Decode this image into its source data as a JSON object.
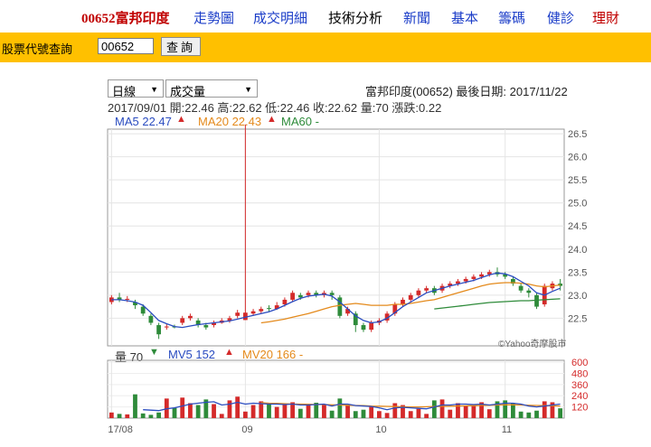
{
  "nav": {
    "brand": "00652富邦印度",
    "links": [
      {
        "label": "走勢圖",
        "color": "#1a3cc8"
      },
      {
        "label": "成交明細",
        "color": "#1a3cc8"
      },
      {
        "label": "技術分析",
        "color": "#000000"
      },
      {
        "label": "新聞",
        "color": "#1a3cc8"
      },
      {
        "label": "基本",
        "color": "#1a3cc8"
      },
      {
        "label": "籌碼",
        "color": "#1a3cc8"
      },
      {
        "label": "健診",
        "color": "#1a3cc8"
      },
      {
        "label": "理財",
        "color": "#c00000"
      }
    ]
  },
  "search": {
    "label": "股票代號查詢",
    "value": "00652",
    "button": "查詢"
  },
  "controls": {
    "period": "日線",
    "indicator": "成交量"
  },
  "info": {
    "title": "富邦印度(00652)  最後日期: 2017/11/22",
    "ohlc": "2017/09/01 開:22.46 高:22.62 低:22.46 收:22.62 量:70 漲跌:0.22",
    "ma5": "MA5 22.47",
    "ma20": "MA20 22.43",
    "ma60": "MA60 -",
    "vol": "量 70",
    "mv5": "MV5 152",
    "mv20": "MV20 166 -"
  },
  "colors": {
    "up": "#d42a2a",
    "down": "#2e8b3a",
    "ma5": "#2a4cc0",
    "ma20": "#e48a1c",
    "ma60": "#2e8b3a"
  },
  "watermark": "©Yahoo奇摩股市",
  "chart_data": {
    "type": "candlestick",
    "price_ticks": [
      22.5,
      23.0,
      23.5,
      24.0,
      24.5,
      25.0,
      25.5,
      26.0,
      26.5
    ],
    "price_range": [
      21.9,
      26.6
    ],
    "volume_ticks": [
      120,
      240,
      360,
      480,
      600
    ],
    "volume_range": [
      0,
      620
    ],
    "x_labels": [
      {
        "label": "17/08",
        "i": 0
      },
      {
        "label": "09",
        "i": 17
      },
      {
        "label": "10",
        "i": 34
      },
      {
        "label": "11",
        "i": 50
      }
    ],
    "candles": [
      {
        "o": 22.85,
        "c": 22.95,
        "h": 23.0,
        "l": 22.8
      },
      {
        "o": 22.95,
        "c": 22.9,
        "h": 23.05,
        "l": 22.85
      },
      {
        "o": 22.9,
        "c": 22.92,
        "h": 22.98,
        "l": 22.85
      },
      {
        "o": 22.85,
        "c": 22.78,
        "h": 22.9,
        "l": 22.7
      },
      {
        "o": 22.75,
        "c": 22.6,
        "h": 22.8,
        "l": 22.55
      },
      {
        "o": 22.55,
        "c": 22.4,
        "h": 22.6,
        "l": 22.35
      },
      {
        "o": 22.35,
        "c": 22.15,
        "h": 22.4,
        "l": 22.05
      },
      {
        "o": 22.3,
        "c": 22.32,
        "h": 22.38,
        "l": 22.25
      },
      {
        "o": 22.32,
        "c": 22.3,
        "h": 22.36,
        "l": 22.28
      },
      {
        "o": 22.4,
        "c": 22.5,
        "h": 22.55,
        "l": 22.35
      },
      {
        "o": 22.5,
        "c": 22.55,
        "h": 22.6,
        "l": 22.45
      },
      {
        "o": 22.45,
        "c": 22.35,
        "h": 22.5,
        "l": 22.3
      },
      {
        "o": 22.35,
        "c": 22.3,
        "h": 22.4,
        "l": 22.25
      },
      {
        "o": 22.35,
        "c": 22.4,
        "h": 22.45,
        "l": 22.3
      },
      {
        "o": 22.4,
        "c": 22.45,
        "h": 22.5,
        "l": 22.38
      },
      {
        "o": 22.45,
        "c": 22.5,
        "h": 22.55,
        "l": 22.4
      },
      {
        "o": 22.55,
        "c": 22.62,
        "h": 22.68,
        "l": 22.5
      },
      {
        "o": 22.46,
        "c": 22.62,
        "h": 26.7,
        "l": 22.46
      },
      {
        "o": 22.6,
        "c": 22.65,
        "h": 22.7,
        "l": 22.55
      },
      {
        "o": 22.65,
        "c": 22.7,
        "h": 22.75,
        "l": 22.6
      },
      {
        "o": 22.72,
        "c": 22.7,
        "h": 22.78,
        "l": 22.65
      },
      {
        "o": 22.7,
        "c": 22.78,
        "h": 22.85,
        "l": 22.68
      },
      {
        "o": 22.8,
        "c": 22.9,
        "h": 22.95,
        "l": 22.75
      },
      {
        "o": 22.9,
        "c": 23.05,
        "h": 23.1,
        "l": 22.85
      },
      {
        "o": 23.0,
        "c": 22.95,
        "h": 23.05,
        "l": 22.9
      },
      {
        "o": 23.0,
        "c": 23.05,
        "h": 23.1,
        "l": 22.95
      },
      {
        "o": 23.05,
        "c": 23.0,
        "h": 23.1,
        "l": 22.95
      },
      {
        "o": 23.0,
        "c": 23.05,
        "h": 23.1,
        "l": 22.95
      },
      {
        "o": 23.05,
        "c": 23.0,
        "h": 23.1,
        "l": 22.9
      },
      {
        "o": 22.95,
        "c": 22.55,
        "h": 23.0,
        "l": 22.5
      },
      {
        "o": 22.6,
        "c": 22.7,
        "h": 22.75,
        "l": 22.55
      },
      {
        "o": 22.6,
        "c": 22.35,
        "h": 22.65,
        "l": 22.2
      },
      {
        "o": 22.35,
        "c": 22.25,
        "h": 22.4,
        "l": 22.2
      },
      {
        "o": 22.25,
        "c": 22.4,
        "h": 22.45,
        "l": 22.2
      },
      {
        "o": 22.4,
        "c": 22.45,
        "h": 22.5,
        "l": 22.35
      },
      {
        "o": 22.45,
        "c": 22.6,
        "h": 22.65,
        "l": 22.4
      },
      {
        "o": 22.6,
        "c": 22.8,
        "h": 22.85,
        "l": 22.55
      },
      {
        "o": 22.8,
        "c": 22.9,
        "h": 22.95,
        "l": 22.75
      },
      {
        "o": 22.9,
        "c": 23.0,
        "h": 23.05,
        "l": 22.85
      },
      {
        "o": 23.0,
        "c": 23.1,
        "h": 23.15,
        "l": 22.95
      },
      {
        "o": 23.1,
        "c": 23.15,
        "h": 23.2,
        "l": 23.05
      },
      {
        "o": 23.15,
        "c": 23.05,
        "h": 23.2,
        "l": 23.0
      },
      {
        "o": 23.1,
        "c": 23.2,
        "h": 23.25,
        "l": 23.05
      },
      {
        "o": 23.2,
        "c": 23.25,
        "h": 23.3,
        "l": 23.15
      },
      {
        "o": 23.25,
        "c": 23.3,
        "h": 23.35,
        "l": 23.2
      },
      {
        "o": 23.3,
        "c": 23.35,
        "h": 23.4,
        "l": 23.25
      },
      {
        "o": 23.35,
        "c": 23.4,
        "h": 23.45,
        "l": 23.3
      },
      {
        "o": 23.4,
        "c": 23.45,
        "h": 23.5,
        "l": 23.35
      },
      {
        "o": 23.45,
        "c": 23.5,
        "h": 23.55,
        "l": 23.4
      },
      {
        "o": 23.5,
        "c": 23.45,
        "h": 23.6,
        "l": 23.4
      },
      {
        "o": 23.45,
        "c": 23.4,
        "h": 23.5,
        "l": 23.35
      },
      {
        "o": 23.35,
        "c": 23.25,
        "h": 23.4,
        "l": 23.2
      },
      {
        "o": 23.2,
        "c": 23.1,
        "h": 23.25,
        "l": 23.05
      },
      {
        "o": 23.1,
        "c": 23.05,
        "h": 23.15,
        "l": 22.95
      },
      {
        "o": 23.0,
        "c": 22.75,
        "h": 23.05,
        "l": 22.7
      },
      {
        "o": 22.8,
        "c": 23.2,
        "h": 23.25,
        "l": 22.75
      },
      {
        "o": 23.15,
        "c": 23.25,
        "h": 23.3,
        "l": 23.1
      },
      {
        "o": 23.25,
        "c": 23.2,
        "h": 23.35,
        "l": 23.1
      }
    ],
    "volumes": [
      60,
      45,
      40,
      255,
      50,
      35,
      60,
      210,
      110,
      220,
      160,
      140,
      200,
      150,
      45,
      190,
      230,
      70,
      140,
      180,
      150,
      120,
      155,
      170,
      100,
      140,
      165,
      150,
      80,
      210,
      140,
      75,
      90,
      120,
      75,
      55,
      160,
      140,
      75,
      100,
      45,
      190,
      200,
      90,
      160,
      130,
      130,
      170,
      95,
      180,
      190,
      160,
      70,
      60,
      80,
      180,
      170,
      105
    ],
    "ma5": [
      22.9,
      22.9,
      22.88,
      22.85,
      22.78,
      22.62,
      22.45,
      22.38,
      22.32,
      22.3,
      22.33,
      22.36,
      22.38,
      22.4,
      22.42,
      22.44,
      22.48,
      22.52,
      22.56,
      22.6,
      22.64,
      22.7,
      22.78,
      22.86,
      22.93,
      22.98,
      23.0,
      23.02,
      22.98,
      22.85,
      22.7,
      22.55,
      22.45,
      22.4,
      22.42,
      22.5,
      22.62,
      22.75,
      22.85,
      22.95,
      23.05,
      23.1,
      23.15,
      23.2,
      23.24,
      23.28,
      23.32,
      23.38,
      23.44,
      23.48,
      23.46,
      23.4,
      23.3,
      23.2,
      23.05,
      23.0,
      23.08,
      23.15
    ],
    "ma20": [
      null,
      null,
      null,
      null,
      null,
      null,
      null,
      null,
      null,
      null,
      null,
      null,
      null,
      null,
      null,
      null,
      null,
      null,
      null,
      22.4,
      22.42,
      22.45,
      22.48,
      22.52,
      22.56,
      22.6,
      22.65,
      22.7,
      22.75,
      22.78,
      22.8,
      22.82,
      22.8,
      22.78,
      22.78,
      22.78,
      22.8,
      22.8,
      22.82,
      22.85,
      22.88,
      22.9,
      22.95,
      23.0,
      23.05,
      23.1,
      23.15,
      23.2,
      23.24,
      23.26,
      23.27,
      23.27,
      23.26,
      23.24,
      23.2,
      23.18,
      23.2,
      23.22
    ],
    "ma60": [
      null,
      null,
      null,
      null,
      null,
      null,
      null,
      null,
      null,
      null,
      null,
      null,
      null,
      null,
      null,
      null,
      null,
      null,
      null,
      null,
      null,
      null,
      null,
      null,
      null,
      null,
      null,
      null,
      null,
      null,
      null,
      null,
      null,
      null,
      null,
      null,
      null,
      null,
      null,
      null,
      null,
      22.7,
      22.72,
      22.74,
      22.76,
      22.78,
      22.8,
      22.82,
      22.84,
      22.85,
      22.86,
      22.87,
      22.88,
      22.88,
      22.89,
      22.9,
      22.91,
      22.92
    ],
    "mv5": [
      null,
      null,
      null,
      null,
      90,
      85,
      80,
      100,
      110,
      130,
      150,
      160,
      170,
      175,
      140,
      150,
      170,
      150,
      160,
      155,
      150,
      150,
      145,
      150,
      140,
      140,
      145,
      150,
      130,
      150,
      150,
      135,
      130,
      125,
      110,
      90,
      110,
      115,
      110,
      105,
      100,
      120,
      140,
      140,
      150,
      150,
      145,
      150,
      140,
      150,
      160,
      160,
      150,
      130,
      120,
      130,
      140,
      150
    ],
    "mv20": [
      null,
      null,
      null,
      null,
      null,
      null,
      null,
      null,
      null,
      null,
      null,
      null,
      null,
      null,
      null,
      null,
      null,
      null,
      null,
      166,
      160,
      158,
      155,
      150,
      150,
      148,
      145,
      145,
      142,
      140,
      138,
      136,
      134,
      130,
      128,
      126,
      124,
      122,
      120,
      120,
      122,
      124,
      126,
      128,
      130,
      132,
      134,
      136,
      138,
      140,
      142,
      142,
      140,
      138,
      136,
      134,
      132,
      130
    ]
  }
}
